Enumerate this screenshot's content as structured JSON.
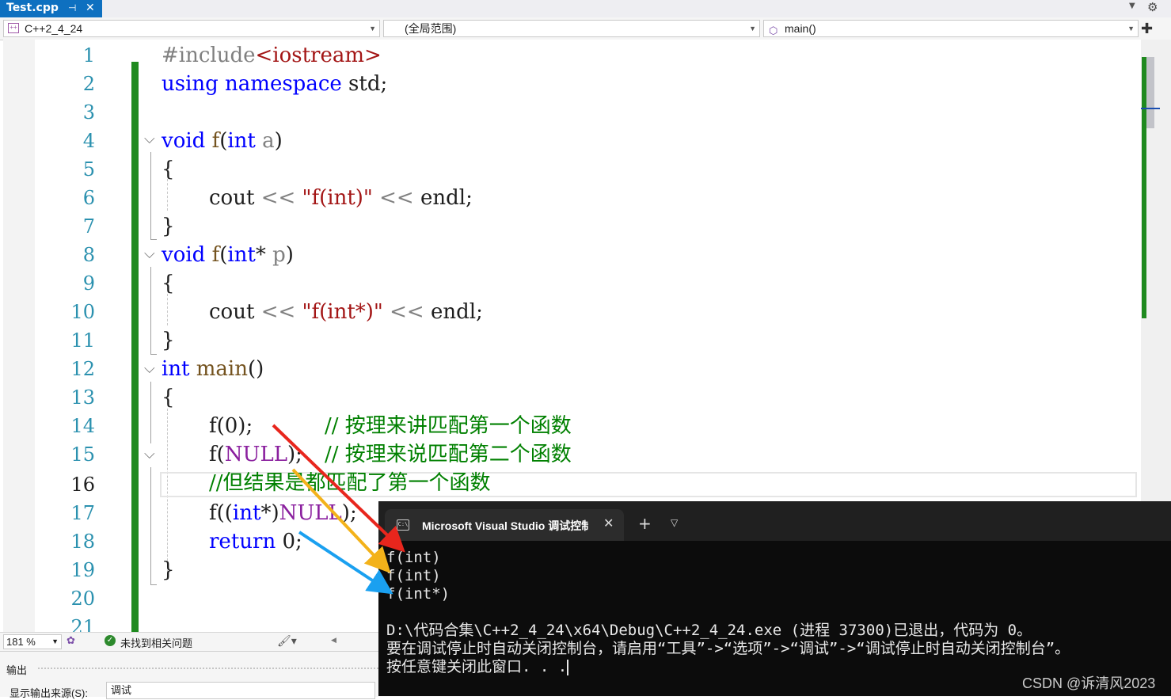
{
  "tab": {
    "title": "Test.cpp",
    "pin": "⊣",
    "close": "✕"
  },
  "navbar": {
    "project": "C++2_4_24",
    "scope": "(全局范围)",
    "function": "main()"
  },
  "editor": {
    "line_numbers": [
      "1",
      "2",
      "3",
      "4",
      "5",
      "6",
      "7",
      "8",
      "9",
      "10",
      "11",
      "12",
      "13",
      "14",
      "15",
      "16",
      "17",
      "18",
      "19",
      "20",
      "21"
    ],
    "current_line": "16",
    "code": {
      "l1_pp": "#include",
      "l1_inc": "<iostream>",
      "l2_kw": "using namespace",
      "l2_rest": " std;",
      "l4_kw": "void",
      "l4_fn": "f",
      "l4_p1": "(",
      "l4_kw2": "int",
      "l4_par": " a",
      "l4_p2": ")",
      "brace_open": "{",
      "brace_close": "}",
      "l6_a": "cout ",
      "l6_op": "<<",
      "l6_str": "\"f(int)\"",
      "l6_b": " endl;",
      "l8_kw": "void",
      "l8_fn": "f",
      "l8_p1": "(",
      "l8_kw2": "int",
      "l8_star": "*",
      "l8_par": " p",
      "l8_p2": ")",
      "l10_str": "\"f(int*)\"",
      "l12_kw": "int",
      "l12_fn": " main",
      "l12_p": "()",
      "l14_code": "f(0);",
      "l14_cm": "// 按理来讲匹配第一个函数",
      "l15_a": "f(",
      "l15_nm": "NULL",
      "l15_b": ");",
      "l15_cm": "// 按理来说匹配第二个函数",
      "l16_cm": "//但结果是都匹配了第一个函数",
      "l17_a": "f((",
      "l17_kw": "int",
      "l17_b": "*)",
      "l17_nm": "NULL",
      "l17_c": ");",
      "l18_kw": "return",
      "l18_b": " 0;"
    }
  },
  "status": {
    "zoom": "181 %",
    "issues": "未找到相关问题"
  },
  "output": {
    "title": "输出",
    "source_label": "显示输出来源(S):",
    "source_value": "调试"
  },
  "terminal": {
    "tab_title": "Microsoft Visual Studio 调试控制台",
    "close": "✕",
    "plus": "+",
    "chevron": "⌄",
    "lines": [
      "f(int)",
      "f(int)",
      "f(int*)",
      "",
      "D:\\代码合集\\C++2_4_24\\x64\\Debug\\C++2_4_24.exe (进程 37300)已退出，代码为 0。",
      "要在调试停止时自动关闭控制台，请启用“工具”->“选项”->“调试”->“调试停止时自动关闭控制台”。",
      "按任意键关闭此窗口. . ."
    ]
  },
  "watermark": "CSDN @诉清风2023",
  "colors": {
    "tab_active": "#0e70c0",
    "keyword": "#0000ff",
    "string": "#a31515",
    "comment": "#008000",
    "change_bar": "#1f8a1f",
    "arrow_red": "#e8261d",
    "arrow_orange": "#f3b21a",
    "arrow_blue": "#1aa0f0"
  }
}
